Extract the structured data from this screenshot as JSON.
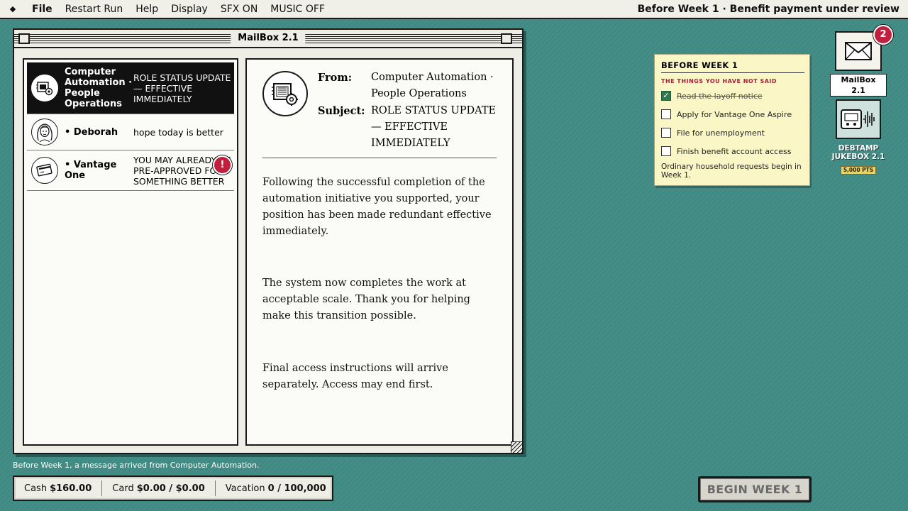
{
  "menubar": {
    "items": [
      "File",
      "Restart Run",
      "Help",
      "Display",
      "SFX ON",
      "MUSIC OFF"
    ],
    "status": "Before Week 1 · Benefit payment under review"
  },
  "mail_window": {
    "title": "MailBox 2.1",
    "messages": [
      {
        "sender": "Computer Automation · People Operations",
        "subject": "ROLE STATUS UPDATE — EFFECTIVE IMMEDIATELY",
        "icon": "automation-chip-icon",
        "selected": true
      },
      {
        "sender": "• Deborah",
        "subject": "hope today is better",
        "icon": "deborah-portrait-icon"
      },
      {
        "sender": "• Vantage One",
        "subject": "YOU MAY ALREADY BE PRE-APPROVED FOR SOMETHING BETTER",
        "icon": "credit-card-icon",
        "alert": "!"
      }
    ],
    "reader": {
      "from_label": "From:",
      "from": "Computer Automation · People Operations",
      "subject_label": "Subject:",
      "subject": "ROLE STATUS UPDATE — EFFECTIVE IMMEDIATELY",
      "paragraphs": [
        "Following the successful completion of the automation initiative you supported, your position has been made redundant effective immediately.",
        "The system now completes the work at acceptable scale. Thank you for helping make this transition possible.",
        "Final access instructions will arrive separately. Access may end first."
      ]
    }
  },
  "note": {
    "title": "BEFORE WEEK 1",
    "subtitle": "THE THINGS YOU HAVE NOT SAID",
    "tasks": [
      {
        "label": "Read the layoff notice",
        "done": true
      },
      {
        "label": "Apply for Vantage One Aspire",
        "done": false
      },
      {
        "label": "File for unemployment",
        "done": false
      },
      {
        "label": "Finish benefit account access",
        "done": false
      }
    ],
    "footer": "Ordinary household requests begin in Week 1."
  },
  "desktop": {
    "mailbox": {
      "label": "MailBox 2.1",
      "badge": "2"
    },
    "jukebox": {
      "label": "DEBTAMP JUKEBOX 2.1",
      "points": "5,000 PTS"
    }
  },
  "status_line": "Before Week 1, a message arrived from Computer Automation.",
  "ledger": {
    "cash_label": "Cash",
    "cash": "$160.00",
    "card_label": "Card",
    "card": "$0.00 / $0.00",
    "vacation_label": "Vacation",
    "vacation": "0 / 100,000"
  },
  "begin_button": "BEGIN WEEK 1",
  "colors": {
    "desktop": "#3f8a83",
    "alert": "#c0203d",
    "note": "#fbf6c6",
    "check": "#2c7a52"
  }
}
